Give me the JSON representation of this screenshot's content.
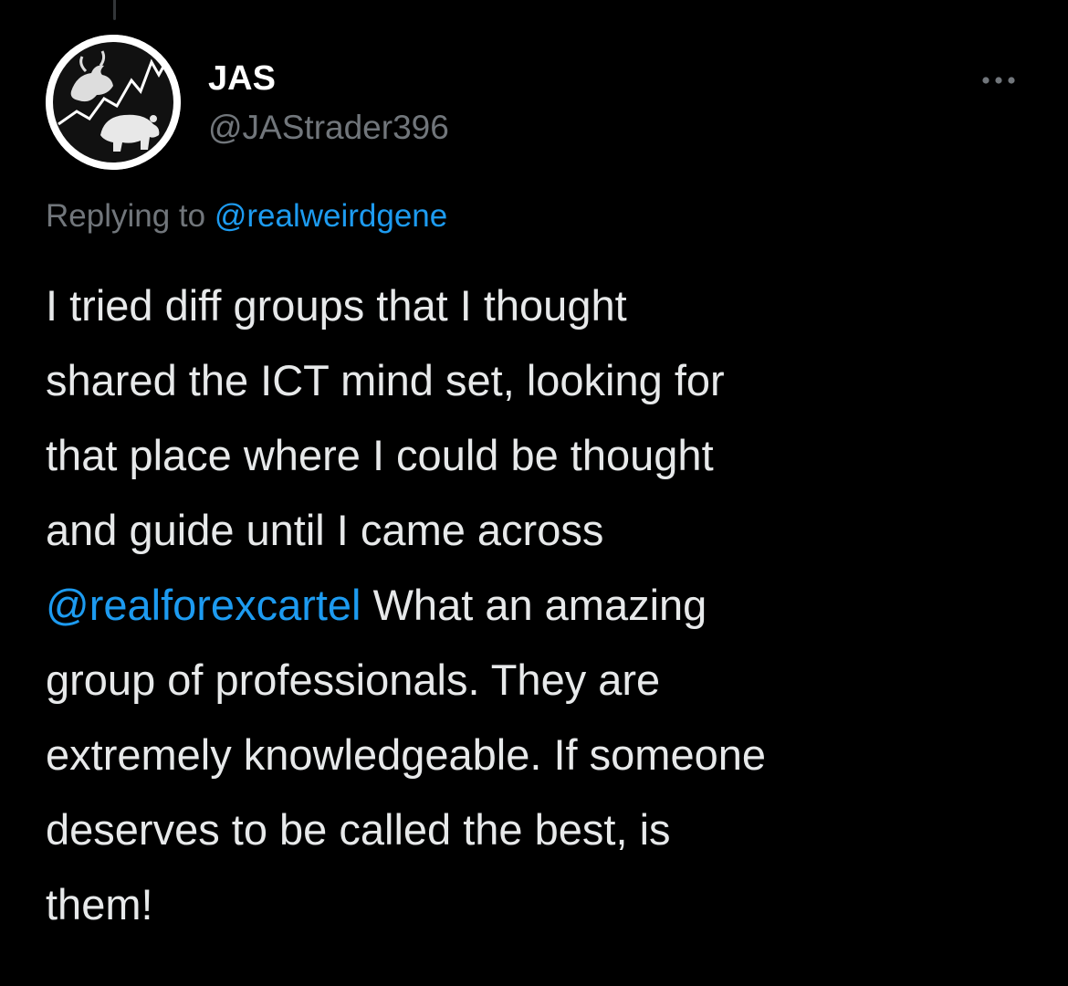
{
  "author": {
    "name": "JAS",
    "handle": "@JAStrader396",
    "avatar_icon": "bull-bear-trading-chart-avatar"
  },
  "more_icon": "more-options-icon",
  "reply_context": {
    "prefix": "Replying to ",
    "mention": "@realweirdgene"
  },
  "tweet": {
    "lines": [
      "I tried diff groups that I thought",
      "shared the ICT mind set, looking for",
      "that place where I could be thought",
      "and guide until I came across"
    ],
    "mention": "@realforexcartel",
    "after_mention": " What an amazing",
    "lines_after": [
      "group of professionals. They are",
      "extremely knowledgeable. If someone",
      "deserves to be called the best, is",
      "them!"
    ]
  },
  "colors": {
    "background": "#000000",
    "text": "#e7e9ea",
    "secondary": "#71767b",
    "link": "#1d9bf0"
  }
}
